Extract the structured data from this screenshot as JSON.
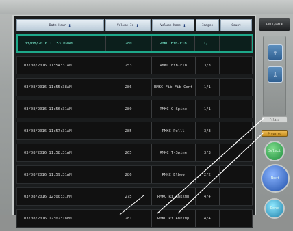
{
  "panel": {
    "columns": [
      {
        "label": "Date·Hour",
        "sortable": true,
        "width": 128
      },
      {
        "label": "Volume Id",
        "sortable": true,
        "width": 66
      },
      {
        "label": "Volume Name",
        "sortable": true,
        "width": 62
      },
      {
        "label": "Images",
        "sortable": false,
        "width": 34
      },
      {
        "label": "Count",
        "sortable": false,
        "width": 46
      }
    ],
    "rows": [
      {
        "datetime": "03/08/2016 11:53:09AM",
        "id": "280",
        "name": "RMKC Fib-Fib",
        "images": "1/1",
        "selected": true
      },
      {
        "datetime": "03/08/2016 11:54:31AM",
        "id": "253",
        "name": "RMKC Fib-Fib",
        "images": "3/3",
        "selected": false
      },
      {
        "datetime": "03/08/2016 11:55:38AM",
        "id": "286",
        "name": "RMKC Fib-Fib-Cont",
        "images": "1/1",
        "selected": false
      },
      {
        "datetime": "03/08/2016 11:56:31AM",
        "id": "280",
        "name": "RMKC C-Spine",
        "images": "1/1",
        "selected": false
      },
      {
        "datetime": "03/08/2016 11:57:31AM",
        "id": "285",
        "name": "RMKC Pelll",
        "images": "3/3",
        "selected": false
      },
      {
        "datetime": "03/08/2016 11:58:31AM",
        "id": "265",
        "name": "RMKC T-Spine",
        "images": "3/3",
        "selected": false
      },
      {
        "datetime": "03/08/2016 11:59:31AM",
        "id": "286",
        "name": "RMKC Elbow",
        "images": "2/2",
        "selected": false
      },
      {
        "datetime": "03/08/2016 12:00:31PM",
        "id": "275",
        "name": "RMKC Ri.Ankkmp",
        "images": "4/4",
        "selected": false
      },
      {
        "datetime": "03/08/2016 12:02:18PM",
        "id": "281",
        "name": "RMKC Ri.Ankkmp",
        "images": "4/4",
        "selected": false
      }
    ]
  },
  "side": {
    "top_button": "EXIT/BACK",
    "up_arrow": "⇧",
    "down_arrow": "⇩",
    "gray_label": "Filter",
    "amber_label": "Prepared",
    "green_button": "Select",
    "blue_button": "Next",
    "teal_button": "Done"
  },
  "colors": {
    "panel_bg": "#1a1c1d",
    "selected_border": "#1ea88a",
    "header_bg": "#c8d6e2",
    "green": "#1c8c3c",
    "blue": "#1f4fa8",
    "amber": "#c68d1d"
  }
}
